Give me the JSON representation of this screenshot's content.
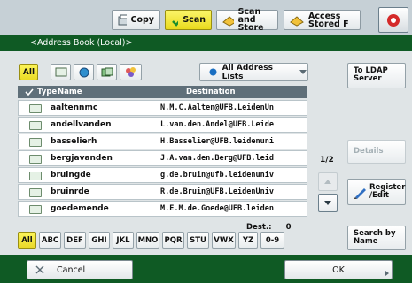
{
  "top_tabs": [
    {
      "label": "Copy",
      "icon": "copy-icon"
    },
    {
      "label": "Scan",
      "icon": "scan-checkmark-icon",
      "active": true
    },
    {
      "label": "Scan and\nStore",
      "icon": "scan-store-icon"
    },
    {
      "label": "Access\nStored F",
      "icon": "access-stored-icon"
    }
  ],
  "header_title": "<Address Book (Local)>",
  "filter": {
    "all_label": "All",
    "address_list_label": "All Address Lists",
    "type_icons": [
      "fax-icon",
      "email-globe-icon",
      "group-icon",
      "folder-icon"
    ]
  },
  "table": {
    "columns": {
      "type": "Type",
      "name": "Name",
      "destination": "Destination"
    },
    "rows": [
      {
        "name": "aaltennmc",
        "destination": "N.M.C.Aalten@UFB.LeidenUn"
      },
      {
        "name": "andellvanden",
        "destination": "L.van.den.Andel@UFB.Leide"
      },
      {
        "name": "basselierh",
        "destination": "H.Basselier@UFB.leidenuni"
      },
      {
        "name": "bergjavanden",
        "destination": "J.A.van.den.Berg@UFB.leid"
      },
      {
        "name": "bruingde",
        "destination": "g.de.bruin@ufb.leidenuniv"
      },
      {
        "name": "bruinrde",
        "destination": "R.de.Bruin@UFB.LeidenUniv"
      },
      {
        "name": "goedemende",
        "destination": "M.E.M.de.Goede@UFB.leiden"
      }
    ],
    "dest_label": "Dest.:",
    "dest_count": "0"
  },
  "pager": {
    "page_label": "1/2"
  },
  "alphabet": [
    "All",
    "ABC",
    "DEF",
    "GHI",
    "JKL",
    "MNO",
    "PQR",
    "STU",
    "VWX",
    "YZ",
    "0-9"
  ],
  "side_buttons": {
    "ldap": "To LDAP\nServer",
    "details": "Details",
    "register": "Register\n/Edit",
    "search": "Search by\nName"
  },
  "bottom": {
    "cancel": "Cancel",
    "ok": "OK"
  },
  "colors": {
    "accent_yellow": "#f2e63a",
    "header_green": "#0f5a24"
  }
}
